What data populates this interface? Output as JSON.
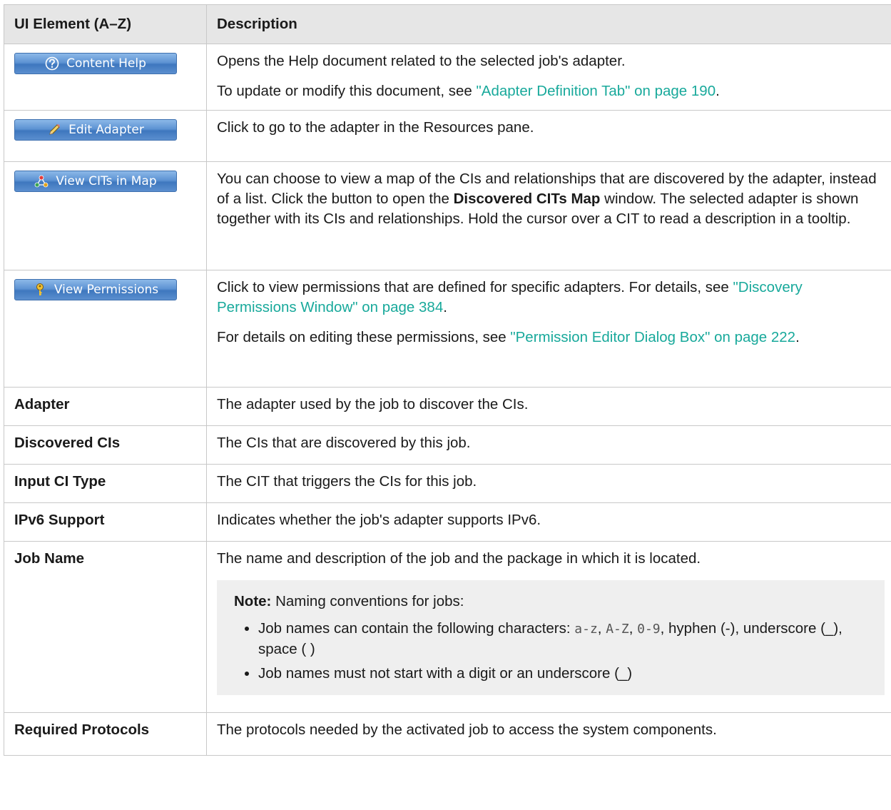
{
  "header": {
    "col1": "UI Element (A–Z)",
    "col2": "Description"
  },
  "rows": {
    "content_help": {
      "button_label": "Content Help",
      "icon": "question-mark-icon",
      "p1": "Opens the Help document related to the selected job's adapter.",
      "p2_pre": "To update or modify this document, see ",
      "p2_link": "\"Adapter Definition Tab\" on page 190",
      "p2_post": "."
    },
    "edit_adapter": {
      "button_label": "Edit Adapter",
      "icon": "pencil-icon",
      "p1": "Click to go to the adapter in the Resources pane."
    },
    "view_cits": {
      "button_label": "View CITs in Map",
      "icon": "map-nodes-icon",
      "p1_pre": "You can choose to view a map of the CIs and relationships that are discovered by the adapter, instead of a list. Click the button to open the ",
      "p1_bold": "Discovered CITs Map",
      "p1_post": " window. The selected adapter is shown together with its CIs and relationships. Hold the cursor over a CIT to read a description in a tooltip."
    },
    "view_permissions": {
      "button_label": "View Permissions",
      "icon": "key-icon",
      "p1_pre": "Click to view permissions that are defined for specific adapters. For details, see ",
      "p1_link": "\"Discovery Permissions Window\" on page 384",
      "p1_post": ".",
      "p2_pre": "For details on editing these permissions, see ",
      "p2_link": "\"Permission Editor Dialog Box\" on page 222",
      "p2_post": "."
    },
    "adapter": {
      "name": "Adapter",
      "desc": "The adapter used by the job to discover the CIs."
    },
    "discovered_cis": {
      "name": "Discovered CIs",
      "desc": "The CIs that are discovered by this job."
    },
    "input_ci_type": {
      "name": "Input CI Type",
      "desc": "The CIT that triggers the CIs for this job."
    },
    "ipv6_support": {
      "name": "IPv6 Support",
      "desc": "Indicates whether the job's adapter supports IPv6."
    },
    "job_name": {
      "name": "Job Name",
      "desc": "The name and description of the job and the package in which it is located.",
      "note_label": "Note:",
      "note_text": " Naming conventions for jobs:",
      "bullet1_pre": "Job names can contain the following characters: ",
      "bullet1_code1": "a-z",
      "bullet1_sep1": ", ",
      "bullet1_code2": "A-Z",
      "bullet1_sep2": ", ",
      "bullet1_code3": "0-9",
      "bullet1_post": ", hyphen (-), underscore (_), space ( )",
      "bullet2": "Job names must not start with a digit or an underscore (_)"
    },
    "required_protocols": {
      "name": "Required Protocols",
      "desc": "The protocols needed by the activated job to access the system components."
    }
  }
}
